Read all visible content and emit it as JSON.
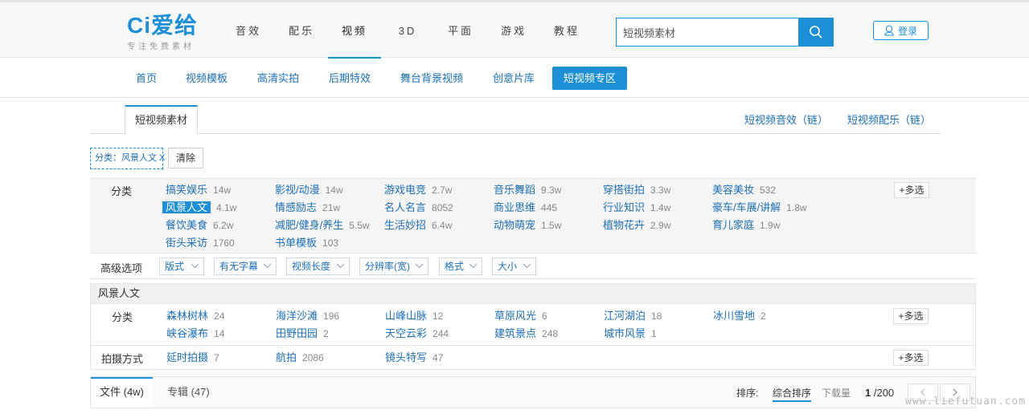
{
  "logo": {
    "brand": "Ci爱给",
    "tagline": "专注免费素材"
  },
  "main_nav": [
    {
      "label": "音效"
    },
    {
      "label": "配乐"
    },
    {
      "label": "视频",
      "active": true
    },
    {
      "label": "3D"
    },
    {
      "label": "平面"
    },
    {
      "label": "游戏"
    },
    {
      "label": "教程"
    }
  ],
  "search": {
    "value": "短视频素材",
    "icon": "search-icon"
  },
  "login": {
    "label": "登录",
    "icon": "user-icon"
  },
  "sub_nav": [
    {
      "label": "首页"
    },
    {
      "label": "视频模板"
    },
    {
      "label": "高清实拍"
    },
    {
      "label": "后期特效"
    },
    {
      "label": "舞台背景视频"
    },
    {
      "label": "创意片库"
    },
    {
      "label": "短视频专区",
      "active": true
    }
  ],
  "tabs": {
    "active": "短视频素材",
    "links": [
      "短视频音效（链）",
      "短视频配乐（链）"
    ]
  },
  "filter_chip": {
    "label": "分类：风景人文 X"
  },
  "clear_button": "清除",
  "category_row": {
    "label": "分类",
    "multi": "+多选",
    "options": [
      {
        "name": "搞笑娱乐",
        "count": "14w"
      },
      {
        "name": "影视/动漫",
        "count": "14w"
      },
      {
        "name": "游戏电竞",
        "count": "2.7w"
      },
      {
        "name": "音乐舞蹈",
        "count": "9.3w"
      },
      {
        "name": "穿搭街拍",
        "count": "3.3w"
      },
      {
        "name": "美容美妆",
        "count": "532"
      },
      {
        "name": "风景人文",
        "count": "4.1w",
        "selected": true
      },
      {
        "name": "情感励志",
        "count": "21w"
      },
      {
        "name": "名人名言",
        "count": "8052"
      },
      {
        "name": "商业思维",
        "count": "445"
      },
      {
        "name": "行业知识",
        "count": "1.4w"
      },
      {
        "name": "豪车/车展/讲解",
        "count": "1.8w"
      },
      {
        "name": "餐饮美食",
        "count": "6.2w"
      },
      {
        "name": "减肥/健身/养生",
        "count": "5.5w"
      },
      {
        "name": "生活妙招",
        "count": "6.4w"
      },
      {
        "name": "动物萌宠",
        "count": "1.5w"
      },
      {
        "name": "植物花卉",
        "count": "2.9w"
      },
      {
        "name": "育儿家庭",
        "count": "1.9w"
      },
      {
        "name": "街头采访",
        "count": "1760"
      },
      {
        "name": "书单模板",
        "count": "103"
      }
    ]
  },
  "advanced": {
    "label": "高级选项",
    "selects": [
      "版式",
      "有无字幕",
      "视频长度",
      "分辨率(宽)",
      "格式",
      "大小"
    ]
  },
  "section": {
    "title": "风景人文",
    "category": {
      "label": "分类",
      "multi": "+多选",
      "options": [
        {
          "name": "森林树林",
          "count": "24"
        },
        {
          "name": "海洋沙滩",
          "count": "196"
        },
        {
          "name": "山峰山脉",
          "count": "12"
        },
        {
          "name": "草原风光",
          "count": "6"
        },
        {
          "name": "江河湖泊",
          "count": "18"
        },
        {
          "name": "冰川雪地",
          "count": "2"
        },
        {
          "name": "峡谷瀑布",
          "count": "14"
        },
        {
          "name": "田野田园",
          "count": "2"
        },
        {
          "name": "天空云彩",
          "count": "244"
        },
        {
          "name": "建筑景点",
          "count": "248"
        },
        {
          "name": "城市风景",
          "count": "1"
        }
      ]
    },
    "shooting": {
      "label": "拍摄方式",
      "multi": "+多选",
      "options": [
        {
          "name": "延时拍摄",
          "count": "7"
        },
        {
          "name": "航拍",
          "count": "2086"
        },
        {
          "name": "镜头特写",
          "count": "47"
        }
      ]
    }
  },
  "bottom": {
    "tabs": [
      {
        "label": "文件 (4w)",
        "active": true
      },
      {
        "label": "专辑 (47)"
      }
    ],
    "sort_label": "排序:",
    "sort_options": [
      {
        "label": "综合排序",
        "active": true
      },
      {
        "label": "下载量"
      }
    ],
    "page_current": "1",
    "page_total": "/200"
  },
  "watermark": "www.liefutuan.com",
  "colors": {
    "accent": "#1c8fd6",
    "link": "#1c6fb8"
  }
}
